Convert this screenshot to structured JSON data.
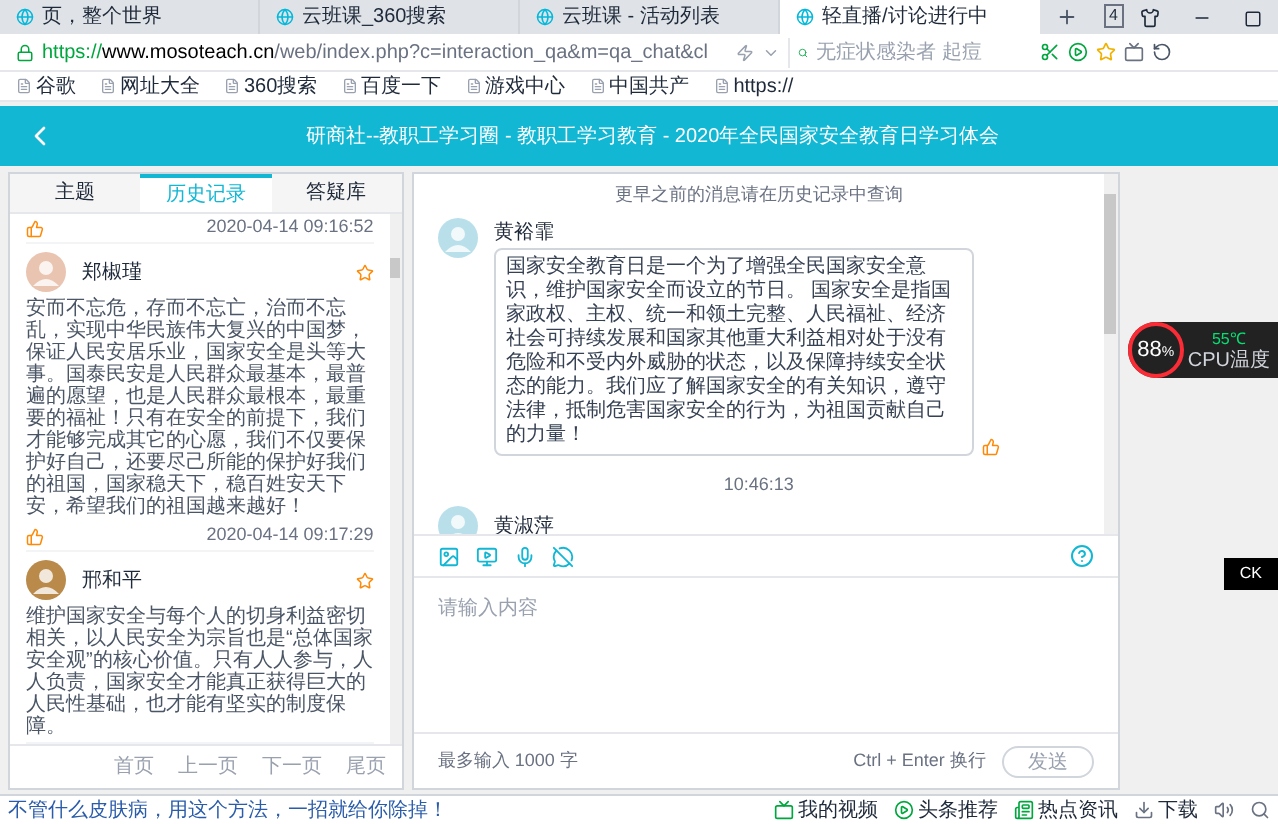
{
  "browser": {
    "tabs": [
      {
        "title": "页，整个世界",
        "selected": false
      },
      {
        "title": "云班课_360搜索",
        "selected": false
      },
      {
        "title": "云班课 - 活动列表",
        "selected": false
      },
      {
        "title": "轻直播/讨论进行中",
        "selected": true
      }
    ],
    "tab_count": "4",
    "url": {
      "scheme": "https://",
      "host": "www.mosoteach.cn",
      "path": "/web/index.php?c=interaction_qa&m=qa_chat&cl"
    },
    "search_placeholder": "无症状感染者 起痘",
    "bookmarks": [
      "谷歌",
      "网址大全",
      "360搜索",
      "百度一下",
      "游戏中心",
      "中国共产",
      "https://"
    ]
  },
  "header": {
    "title": "研商社--教职工学习圈 - 教职工学习教育 - 2020年全民国家安全教育日学习体会"
  },
  "history_panel": {
    "tabs": [
      {
        "label": "主题",
        "selected": false
      },
      {
        "label": "历史记录",
        "selected": true
      },
      {
        "label": "答疑库",
        "selected": false
      }
    ],
    "top_time": "2020-04-14 09:16:52",
    "posts": [
      {
        "author": "郑椒瑾",
        "text": "安而不忘危，存而不忘亡，治而不忘乱，实现中华民族伟大复兴的中国梦，保证人民安居乐业，国家安全是头等大事。国泰民安是人民群众最基本，最普遍的愿望，也是人民群众最根本，最重要的福祉！只有在安全的前提下，我们才能够完成其它的心愿，我们不仅要保护好自己，还要尽己所能的保护好我们的祖国，国家稳天下，稳百姓安天下安，希望我们的祖国越来越好！",
        "time": "2020-04-14 09:17:29"
      },
      {
        "author": "邢和平",
        "text": "维护国家安全与每个人的切身利益密切相关，以人民安全为宗旨也是“总体国家安全观”的核心价值。只有人人参与，人人负责，国家安全才能真正获得巨大的人民性基础，也才能有坚实的制度保障。"
      }
    ],
    "pager": [
      "首页",
      "上一页",
      "下一页",
      "尾页"
    ]
  },
  "chat": {
    "notice": "更早之前的消息请在历史记录中查询",
    "messages": [
      {
        "author": "黄裕霏",
        "text": "国家安全教育日是一个为了增强全民国家安全意识，维护国家安全而设立的节日。 国家安全是指国家政权、主权、统一和领土完整、人民福祉、经济社会可持续发展和国家其他重大利益相对处于没有危险和不受内外威胁的状态，以及保障持续安全状态的能力。我们应了解国家安全的有关知识，遵守法律，抵制危害国家安全的行为，为祖国贡献自己的力量！"
      }
    ],
    "time": "10:46:13",
    "next_author": "黄淑萍",
    "input": {
      "placeholder": "请输入内容"
    },
    "limit": "最多输入 1000 字",
    "shortcut": "Ctrl + Enter 换行",
    "send": "发送"
  },
  "cpu_widget": {
    "usage": "88",
    "unit": "%",
    "temp": "55℃",
    "label": "CPU温度"
  },
  "ime_badge": "CK",
  "status_bar": {
    "news": "不管什么皮肤病，用这个方法，一招就给你除掉！",
    "items": [
      {
        "kind": "video",
        "label": "我的视频"
      },
      {
        "kind": "headline",
        "label": "头条推荐"
      },
      {
        "kind": "news",
        "label": "热点资讯"
      },
      {
        "kind": "download",
        "label": "下载"
      }
    ]
  }
}
